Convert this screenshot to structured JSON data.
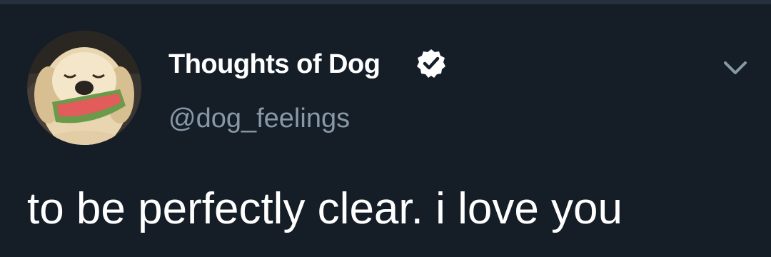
{
  "tweet": {
    "author": {
      "display_name": "Thoughts of Dog",
      "handle": "@dog_feelings",
      "verified": true,
      "avatar": "dog-with-watermelon-avatar"
    },
    "text": "to be perfectly clear. i love you"
  },
  "icons": {
    "verified": "verified-badge-icon",
    "more": "chevron-down-icon"
  },
  "colors": {
    "background": "#151d27",
    "top_strip": "#24303d",
    "primary_text": "#ffffff",
    "secondary_text": "#8899a6",
    "chevron": "#8899a6"
  }
}
